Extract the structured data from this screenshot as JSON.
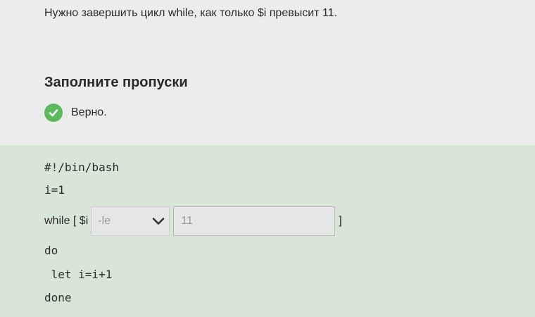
{
  "task": {
    "description": "Нужно завершить цикл while, как только $i превысит 11."
  },
  "question": {
    "heading": "Заполните пропуски",
    "status_text": "Верно.",
    "status_icon": "check-circle-icon",
    "status_color": "#5cb85c"
  },
  "code": {
    "line1": "#!/bin/bash",
    "line2": "i=1",
    "while_prefix": "while [ $i",
    "select_value": "-le",
    "input_value": "11",
    "while_suffix": "]",
    "line_do": "do",
    "line_let": " let i=i+1",
    "line_done": "done"
  },
  "colors": {
    "answer_background": "#d8e6d8",
    "page_background": "#ececec"
  }
}
